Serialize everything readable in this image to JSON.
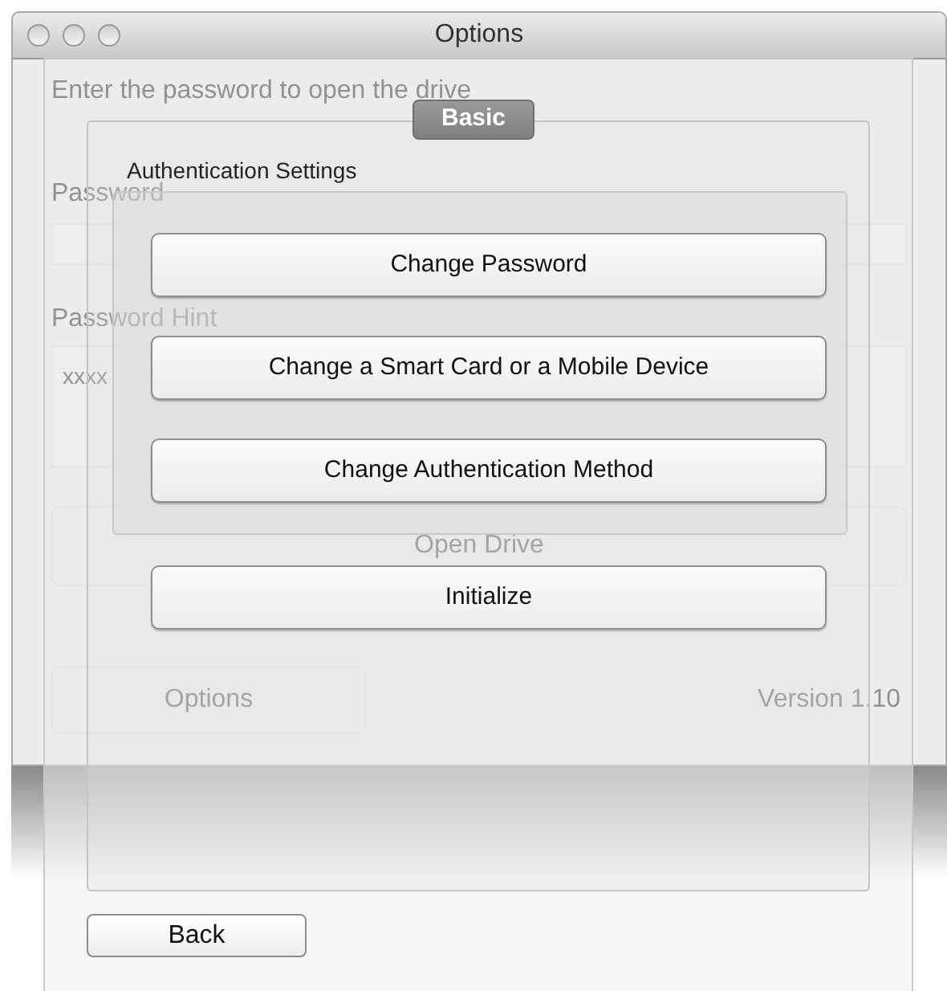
{
  "window": {
    "title": "Options"
  },
  "background_window": {
    "prompt": "Enter the password to open the drive",
    "password_label": "Password",
    "hint_label": "Password Hint",
    "hint_value": "xxxx",
    "open_button": "Open Drive",
    "options_button": "Options",
    "version": "Version 1.10"
  },
  "sheet": {
    "tab": "Basic",
    "group_label": "Authentication Settings",
    "group_buttons": [
      "Change Password",
      "Change a Smart Card or a Mobile Device",
      "Change Authentication Method"
    ],
    "buttons": [
      "Initialize"
    ],
    "back_button": "Back"
  }
}
